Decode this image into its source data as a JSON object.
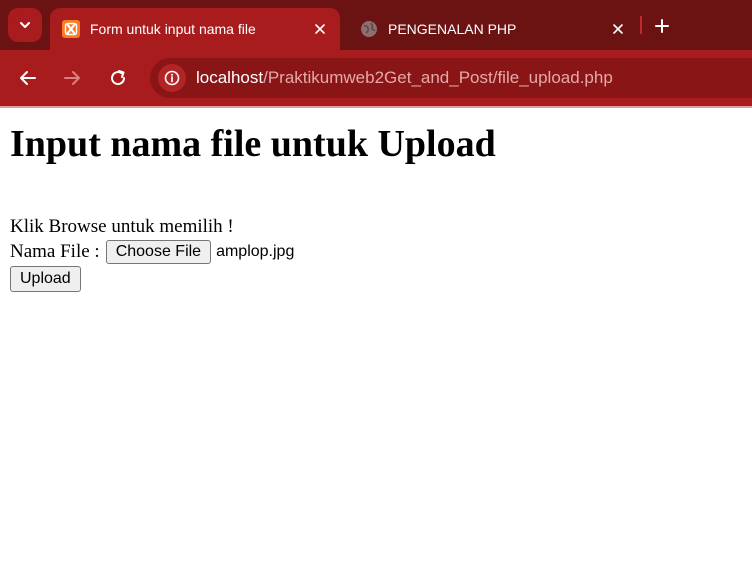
{
  "browser": {
    "tabs": [
      {
        "title": "Form untuk input nama file",
        "favicon": "xampp-icon",
        "active": true
      },
      {
        "title": "PENGENALAN PHP",
        "favicon": "globe-icon",
        "active": false
      }
    ],
    "new_tab": "+",
    "url_host": "localhost",
    "url_path": "/Praktikumweb2Get_and_Post/file_upload.php",
    "colors": {
      "frame": "#6b1213",
      "toolbar": "#a81c1e",
      "omnibox": "#8a1517"
    }
  },
  "page": {
    "title": "Input nama file untuk Upload",
    "instruction": "Klik Browse untuk memilih !",
    "file_label": "Nama File :",
    "choose_button": "Choose File",
    "file_name": "amplop.jpg",
    "upload_button": "Upload"
  }
}
